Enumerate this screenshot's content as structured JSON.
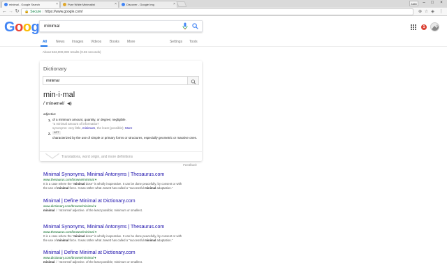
{
  "browser": {
    "tabs": [
      {
        "title": "minimal - Google Search",
        "favicon_color": "#4285f4"
      },
      {
        "title": "Pure White Minimalist",
        "favicon_color": "#e0a82e"
      },
      {
        "title": "Discover - Google Img",
        "favicon_color": "#4285f4"
      }
    ],
    "profile_label": "Justin",
    "address": {
      "secure_label": "Secure",
      "url": "https://www.google.com/"
    }
  },
  "google": {
    "logo": [
      "G",
      "o",
      "o",
      "g",
      "l",
      "e"
    ],
    "logo_colors": [
      "#4285f4",
      "#ea4335",
      "#fbbc05",
      "#4285f4",
      "#34a853",
      "#ea4335"
    ],
    "query": "minimal",
    "notification_count": "1",
    "nav": {
      "all": "All",
      "news": "News",
      "images": "Images",
      "videos": "Videos",
      "books": "Books",
      "more": "More",
      "settings": "Settings",
      "tools": "Tools"
    },
    "result_stats": "About 523,000,000 results (0.55 seconds)"
  },
  "dictionary": {
    "title": "Dictionary",
    "query": "minimal",
    "word": "min·i·mal",
    "phonetic": "/ˈminəməl/",
    "part_of_speech": "adjective",
    "defs": [
      {
        "num": "1.",
        "text": "of a minimum amount, quantity, or degree; negligible.",
        "example": "\"a minimal amount of information\"",
        "syn_prefix": "synonyms: very little, ",
        "syn_link": "minimum",
        "syn_suffix": ", the least (possible);",
        "more": "More"
      },
      {
        "num": "2.",
        "label": "ART",
        "text": "characterized by the use of simple or primary forms or structures, especially geometric or massive ones."
      }
    ],
    "more_defs": "Translations, word origin, and more definitions",
    "feedback": "Feedback"
  },
  "results": [
    {
      "title": "Minimal Synonyms, Minimal Antonyms | Thesaurus.com",
      "url": "www.thesaurus.com/browse/minimal",
      "snippet_1": "It is a case where the \"",
      "snippet_1b": "minimal",
      "snippet_1c": " dose\" is wholly inoperative. It can be done peacefully, by consent or with",
      "snippet_2a": "the use of ",
      "snippet_2b": "minimal",
      "snippet_2c": " force. It was rather what Jowett has called a \"successful ",
      "snippet_2d": "minimal",
      "snippet_2e": " adaptation.\""
    },
    {
      "title": "Minimal | Define Minimal at Dictionary.com",
      "url": "www.dictionary.com/browse/minimal",
      "snippet_1": "",
      "snippet_1b": "minimal",
      "snippet_1c": ". / ˈmɪnəməl/ adjective. of the least possible; minimum or smallest."
    },
    {
      "title": "Minimal Synonyms, Minimal Antonyms | Thesaurus.com",
      "url": "www.thesaurus.com/browse/minimal",
      "snippet_1": "It is a case where the \"",
      "snippet_1b": "minimal",
      "snippet_1c": " dose\" is wholly inoperative. It can be done peacefully, by consent or with",
      "snippet_2a": "the use of ",
      "snippet_2b": "minimal",
      "snippet_2c": " force. It was rather what Jowett has called a \"successful ",
      "snippet_2d": "minimal",
      "snippet_2e": " adaptation.\""
    },
    {
      "title": "Minimal | Define Minimal at Dictionary.com",
      "url": "www.dictionary.com/browse/minimal",
      "snippet_1": "",
      "snippet_1b": "minimal",
      "snippet_1c": ". / ˈmɪnəməl/ adjective. of the least possible; minimum or smallest."
    }
  ]
}
